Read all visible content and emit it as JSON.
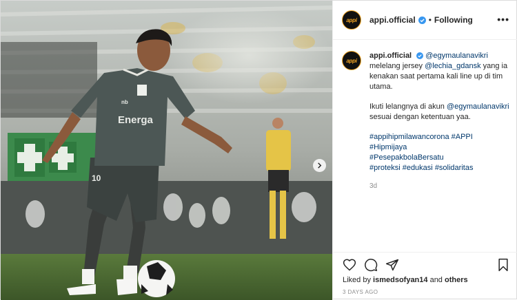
{
  "header": {
    "avatar_text": "appi",
    "username": "appi.official",
    "separator": "•",
    "follow_status": "Following",
    "more": "•••"
  },
  "caption": {
    "username": "appi.official",
    "mention_1": "@egymaulanavikri",
    "text_1": " melelang jersey ",
    "mention_2": "@lechia_gdansk",
    "text_2": " yang ia kenakan saat pertama kali line up di tim utama.",
    "text_3": "Ikuti lelangnya di akun ",
    "mention_3": "@egymaulanavikri",
    "text_4": " sesuai dengan ketentuan yaa.",
    "hashtag_1": "#appihipmilawancorona",
    "hashtag_2": "#APPI",
    "hashtag_3": "#Hipmijaya",
    "hashtag_4": "#PesepakbolaBersatu",
    "hashtag_5": "#proteksi",
    "hashtag_6": "#edukasi",
    "hashtag_7": "#solidaritas",
    "time_ago": "3d"
  },
  "photo": {
    "shirt_sponsor": "Energa",
    "shirt_brand": "nb",
    "shirt_number": "10"
  },
  "footer": {
    "liked_by_prefix": "Liked by ",
    "liked_by_user": "ismedsofyan14",
    "liked_by_and": " and ",
    "liked_by_others": "others",
    "date": "3 DAYS AGO"
  },
  "colors": {
    "link": "#00376b",
    "verified": "#3897f0",
    "muted": "#8e8e8e",
    "avatar_ring": "#f5a623"
  },
  "icons": {
    "verified": "verified-badge-icon",
    "like": "heart-icon",
    "comment": "comment-icon",
    "share": "paper-plane-icon",
    "save": "bookmark-icon",
    "next": "chevron-right-icon"
  }
}
